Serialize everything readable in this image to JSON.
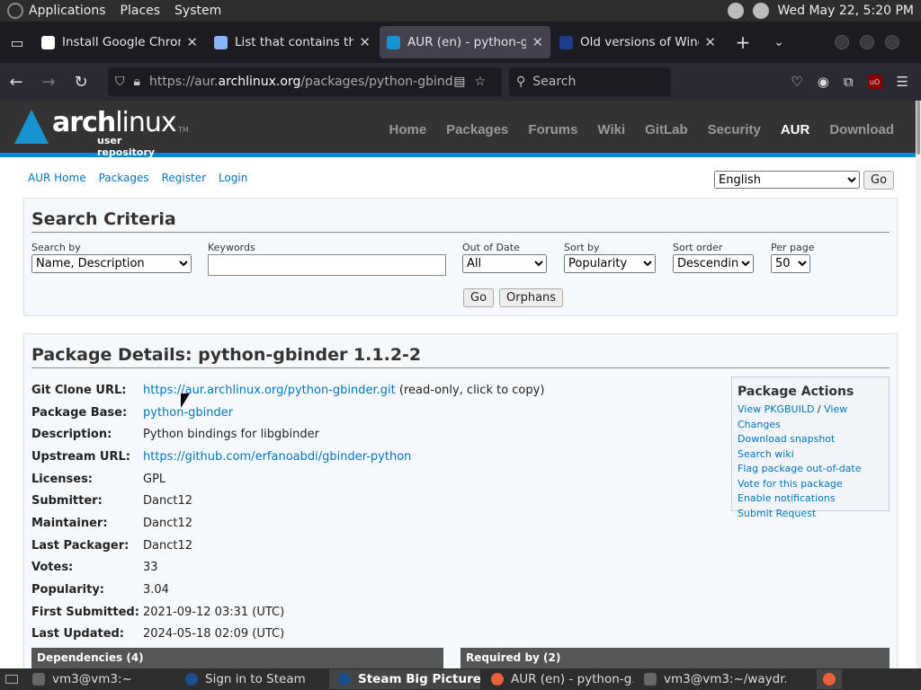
{
  "panel": {
    "applications": "Applications",
    "places": "Places",
    "system": "System",
    "datetime": "Wed May 22,  5:20 PM"
  },
  "tabs": [
    {
      "title": "Install Google Chrome",
      "favicon_color": "#ffffff"
    },
    {
      "title": "List that contains the L",
      "favicon_color": "#8ab4f8"
    },
    {
      "title": "AUR (en) - python-gbi",
      "favicon_color": "#1793d1"
    },
    {
      "title": "Old versions of Windo",
      "favicon_color": "#1e3a8a"
    }
  ],
  "navbar": {
    "url_prefix": "https://aur.",
    "url_domain": "archlinux.org",
    "url_path": "/packages/python-gbinder",
    "search_placeholder": "Search"
  },
  "arch": {
    "logo_text_bold": "arch",
    "logo_text": "linux",
    "logo_sub": "user repository",
    "logo_tm": "TM",
    "nav": [
      "Home",
      "Packages",
      "Forums",
      "Wiki",
      "GitLab",
      "Security",
      "AUR",
      "Download"
    ]
  },
  "subnav": [
    "AUR Home",
    "Packages",
    "Register",
    "Login"
  ],
  "language": {
    "selected": "English",
    "go": "Go"
  },
  "search": {
    "title": "Search Criteria",
    "search_by_label": "Search by",
    "search_by_value": "Name, Description",
    "keywords_label": "Keywords",
    "keywords_value": "",
    "out_of_date_label": "Out of Date",
    "out_of_date_value": "All",
    "sort_by_label": "Sort by",
    "sort_by_value": "Popularity",
    "sort_order_label": "Sort order",
    "sort_order_value": "Descending",
    "per_page_label": "Per page",
    "per_page_value": "50",
    "go": "Go",
    "orphans": "Orphans"
  },
  "details": {
    "title": "Package Details: python-gbinder 1.1.2-2",
    "rows": [
      {
        "key": "Git Clone URL:",
        "link": "https://aur.archlinux.org/python-gbinder.git",
        "text": " (read-only, click to copy)"
      },
      {
        "key": "Package Base:",
        "link": "python-gbinder",
        "text": ""
      },
      {
        "key": "Description:",
        "link": "",
        "text": "Python bindings for libgbinder"
      },
      {
        "key": "Upstream URL:",
        "link": "https://github.com/erfanoabdi/gbinder-python",
        "text": ""
      },
      {
        "key": "Licenses:",
        "link": "",
        "text": "GPL"
      },
      {
        "key": "Submitter:",
        "link": "",
        "text": "Danct12"
      },
      {
        "key": "Maintainer:",
        "link": "",
        "text": "Danct12"
      },
      {
        "key": "Last Packager:",
        "link": "",
        "text": "Danct12"
      },
      {
        "key": "Votes:",
        "link": "",
        "text": "33"
      },
      {
        "key": "Popularity:",
        "link": "",
        "text": "3.04"
      },
      {
        "key": "First Submitted:",
        "link": "",
        "text": "2021-09-12 03:31 (UTC)"
      },
      {
        "key": "Last Updated:",
        "link": "",
        "text": "2024-05-18 02:09 (UTC)"
      }
    ],
    "actions_title": "Package Actions",
    "action_view_pkgbuild": "View PKGBUILD",
    "action_sep": " / ",
    "action_view_changes": "View Changes",
    "actions": [
      "Download snapshot",
      "Search wiki",
      "Flag package out-of-date",
      "Vote for this package",
      "Enable notifications",
      "Submit Request"
    ],
    "dependencies": "Dependencies (4)",
    "required_by": "Required by (2)"
  },
  "taskbar": [
    {
      "label": "vm3@vm3:~",
      "active": false
    },
    {
      "label": "Sign in to Steam",
      "active": false
    },
    {
      "label": "Steam Big Picture ...",
      "active": true
    },
    {
      "label": "AUR (en) - python-g...",
      "active": false
    },
    {
      "label": "vm3@vm3:~/waydr...",
      "active": false
    }
  ]
}
